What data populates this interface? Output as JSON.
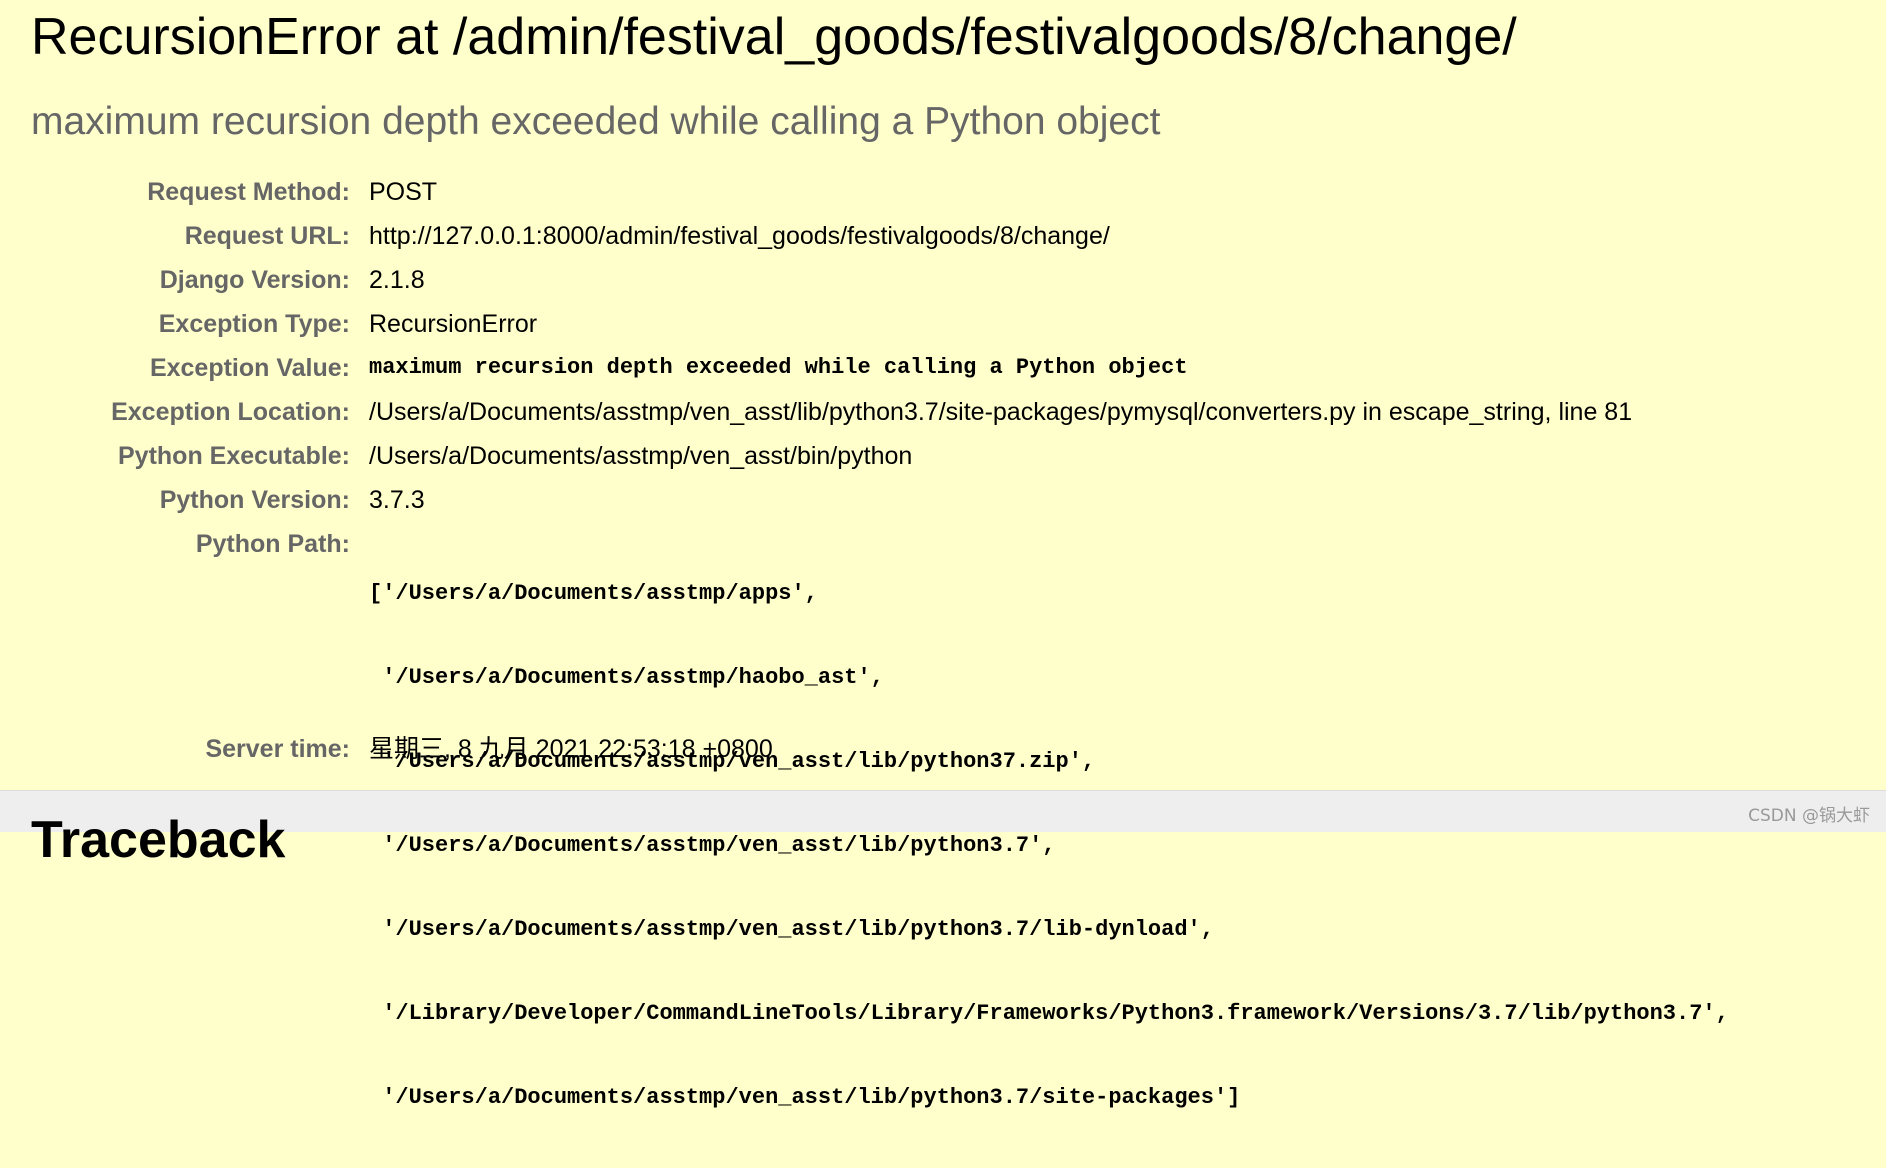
{
  "summary": {
    "title": "RecursionError at /admin/festival_goods/festivalgoods/8/change/",
    "subtitle": "maximum recursion depth exceeded while calling a Python object",
    "meta": {
      "request_method": {
        "label": "Request Method:",
        "value": "POST"
      },
      "request_url": {
        "label": "Request URL:",
        "value": "http://127.0.0.1:8000/admin/festival_goods/festivalgoods/8/change/"
      },
      "django_version": {
        "label": "Django Version:",
        "value": "2.1.8"
      },
      "exception_type": {
        "label": "Exception Type:",
        "value": "RecursionError"
      },
      "exception_value": {
        "label": "Exception Value:",
        "value": "maximum recursion depth exceeded while calling a Python object"
      },
      "exception_location": {
        "label": "Exception Location:",
        "value": "/Users/a/Documents/asstmp/ven_asst/lib/python3.7/site-packages/pymysql/converters.py in escape_string, line 81"
      },
      "python_executable": {
        "label": "Python Executable:",
        "value": "/Users/a/Documents/asstmp/ven_asst/bin/python"
      },
      "python_version": {
        "label": "Python Version:",
        "value": "3.7.3"
      },
      "python_path": {
        "label": "Python Path:",
        "lines": [
          "['/Users/a/Documents/asstmp/apps',",
          " '/Users/a/Documents/asstmp/haobo_ast',",
          " '/Users/a/Documents/asstmp/ven_asst/lib/python37.zip',",
          " '/Users/a/Documents/asstmp/ven_asst/lib/python3.7',",
          " '/Users/a/Documents/asstmp/ven_asst/lib/python3.7/lib-dynload',",
          " '/Library/Developer/CommandLineTools/Library/Frameworks/Python3.framework/Versions/3.7/lib/python3.7',",
          " '/Users/a/Documents/asstmp/ven_asst/lib/python3.7/site-packages']"
        ]
      },
      "server_time": {
        "label": "Server time:",
        "value": "星期三, 8 九月 2021 22:53:18 +0800"
      }
    }
  },
  "traceback": {
    "heading": "Traceback"
  },
  "watermark": "CSDN @锅大虾",
  "colors": {
    "summary_bg": "#ffffcc",
    "label": "#666666",
    "traceback_bg": "#eeeeee"
  }
}
